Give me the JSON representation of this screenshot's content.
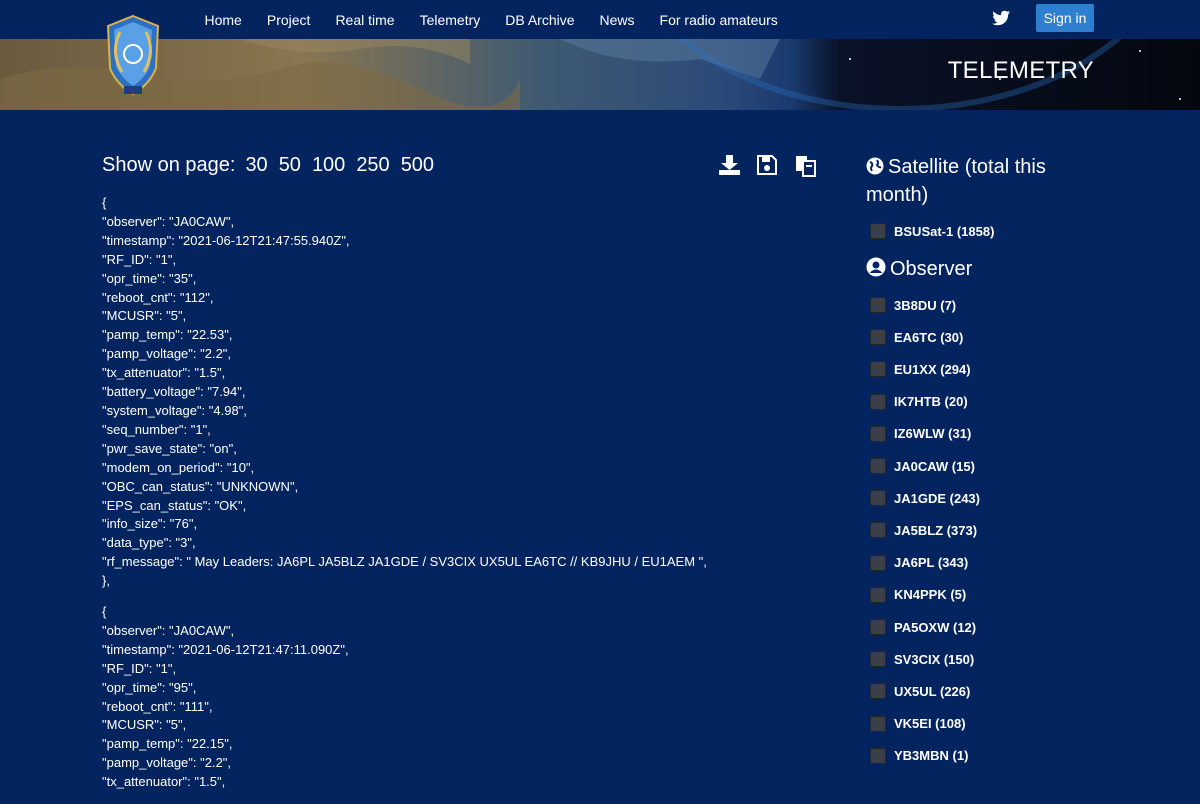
{
  "nav": {
    "links": [
      "Home",
      "Project",
      "Real time",
      "Telemetry",
      "DB Archive",
      "News",
      "For radio amateurs"
    ],
    "signin_label": "Sign in"
  },
  "hero": {
    "title": "TELEMETRY"
  },
  "pagination": {
    "label": "Show on page:",
    "options": [
      "30",
      "50",
      "100",
      "250",
      "500"
    ]
  },
  "toolbar": {
    "icons": [
      "download-icon",
      "save-icon",
      "copy-icon"
    ]
  },
  "records": [
    [
      "{",
      "\"observer\": \"JA0CAW\",",
      "\"timestamp\": \"2021-06-12T21:47:55.940Z\",",
      "\"RF_ID\": \"1\",",
      "\"opr_time\": \"35\",",
      "\"reboot_cnt\": \"112\",",
      "\"MCUSR\": \"5\",",
      "\"pamp_temp\": \"22.53\",",
      "\"pamp_voltage\": \"2.2\",",
      "\"tx_attenuator\": \"1.5\",",
      "\"battery_voltage\": \"7.94\",",
      "\"system_voltage\": \"4.98\",",
      "\"seq_number\": \"1\",",
      "\"pwr_save_state\": \"on\",",
      "\"modem_on_period\": \"10\",",
      "\"OBC_can_status\": \"UNKNOWN\",",
      "\"EPS_can_status\": \"OK\",",
      "\"info_size\": \"76\",",
      "\"data_type\": \"3\",",
      "\"rf_message\": \" May Leaders: JA6PL JA5BLZ JA1GDE / SV3CIX UX5UL EA6TC // KB9JHU / EU1AEM \",",
      "},"
    ],
    [
      "{",
      "\"observer\": \"JA0CAW\",",
      "\"timestamp\": \"2021-06-12T21:47:11.090Z\",",
      "\"RF_ID\": \"1\",",
      "\"opr_time\": \"95\",",
      "\"reboot_cnt\": \"111\",",
      "\"MCUSR\": \"5\",",
      "\"pamp_temp\": \"22.15\",",
      "\"pamp_voltage\": \"2.2\",",
      "\"tx_attenuator\": \"1.5\","
    ]
  ],
  "sidebar": {
    "satellite_heading": "Satellite (total this month)",
    "satellites": [
      "BSUSat-1 (1858)"
    ],
    "observer_heading": "Observer",
    "observers": [
      "3B8DU (7)",
      "EA6TC (30)",
      "EU1XX (294)",
      "IK7HTB (20)",
      "IZ6WLW (31)",
      "JA0CAW (15)",
      "JA1GDE (243)",
      "JA5BLZ (373)",
      "JA6PL (343)",
      "KN4PPK (5)",
      "PA5OXW (12)",
      "SV3CIX (150)",
      "UX5UL (226)",
      "VK5EI (108)",
      "YB3MBN (1)"
    ]
  },
  "colors": {
    "background": "#03245f",
    "accent": "#2f7fd0",
    "checkbox": "#3a3f4a"
  }
}
